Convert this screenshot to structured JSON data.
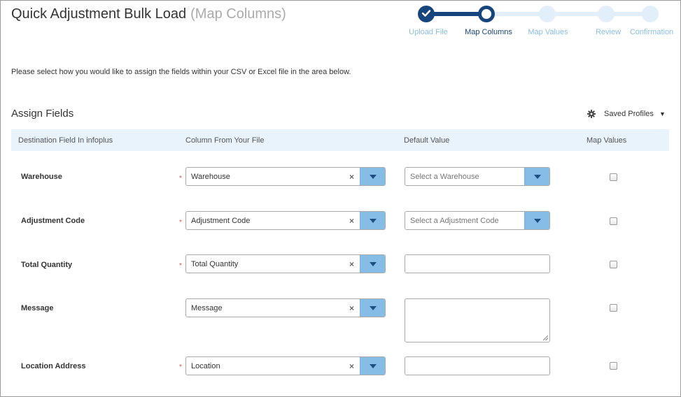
{
  "header": {
    "title": "Quick Adjustment Bulk Load",
    "subtitle": "(Map Columns)"
  },
  "wizard": {
    "steps": [
      {
        "label": "Upload File",
        "state": "done"
      },
      {
        "label": "Map Columns",
        "state": "current"
      },
      {
        "label": "Map Values",
        "state": "todo"
      },
      {
        "label": "Review",
        "state": "todo"
      },
      {
        "label": "Confirmation",
        "state": "todo"
      }
    ]
  },
  "instructions": "Please select how you would like to assign the fields within your CSV or Excel file in the area below.",
  "assign": {
    "title": "Assign Fields",
    "saved_profiles_label": "Saved Profiles",
    "saved_profiles_icon": "gear-icon"
  },
  "table": {
    "headers": [
      "Destination Field In infoplus",
      "Column From Your File",
      "Default Value",
      "Map Values"
    ],
    "rows": [
      {
        "label": "Warehouse",
        "required": true,
        "column_value": "Warehouse",
        "default_type": "select",
        "default_placeholder": "Select a Warehouse",
        "map_values": false
      },
      {
        "label": "Adjustment Code",
        "required": true,
        "column_value": "Adjustment Code",
        "default_type": "select",
        "default_placeholder": "Select a Adjustment Code",
        "map_values": false
      },
      {
        "label": "Total Quantity",
        "required": true,
        "column_value": "Total Quantity",
        "default_type": "text",
        "default_value": "",
        "map_values": false
      },
      {
        "label": "Message",
        "required": false,
        "column_value": "Message",
        "default_type": "textarea",
        "default_value": "",
        "map_values": false
      },
      {
        "label": "Location Address",
        "required": true,
        "column_value": "Location",
        "default_type": "text",
        "default_value": "",
        "map_values": false
      }
    ]
  },
  "symbols": {
    "required": "*",
    "clear": "×",
    "caret": "▼"
  },
  "colors": {
    "accent_dark": "#17457e",
    "accent_light": "#85bde6",
    "header_bg": "#e9f3fc",
    "required": "#d9534f"
  }
}
